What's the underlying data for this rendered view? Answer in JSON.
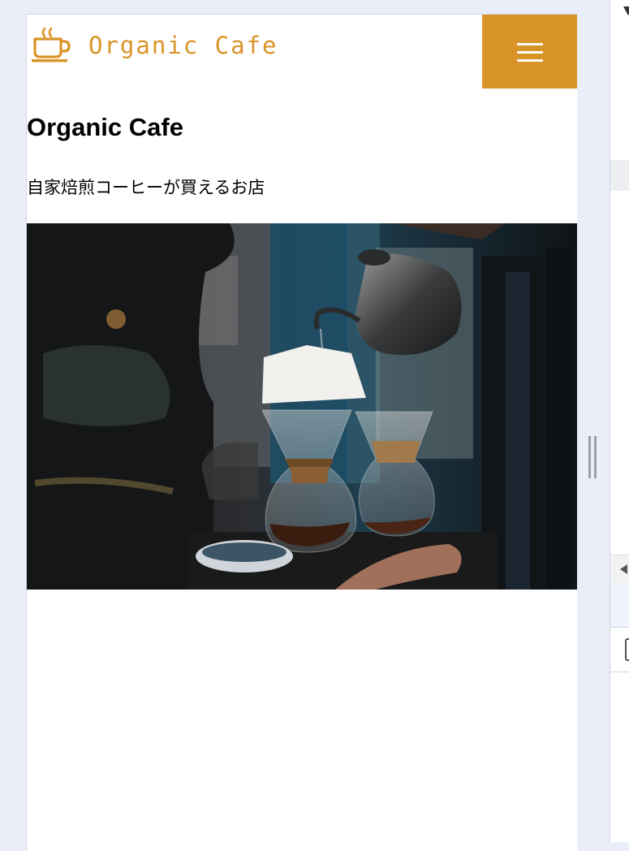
{
  "header": {
    "logo_text": "Organic Cafe",
    "logo_icon": "coffee-cup-icon",
    "menu_icon": "hamburger-menu-icon"
  },
  "main": {
    "title": "Organic Cafe",
    "tagline": "自家焙煎コーヒーが買えるお店"
  },
  "hero": {
    "image": "pour-over-coffee-photo"
  },
  "colors": {
    "accent": "#d99428",
    "page_bg": "#e9eef8",
    "text": "#000000"
  }
}
